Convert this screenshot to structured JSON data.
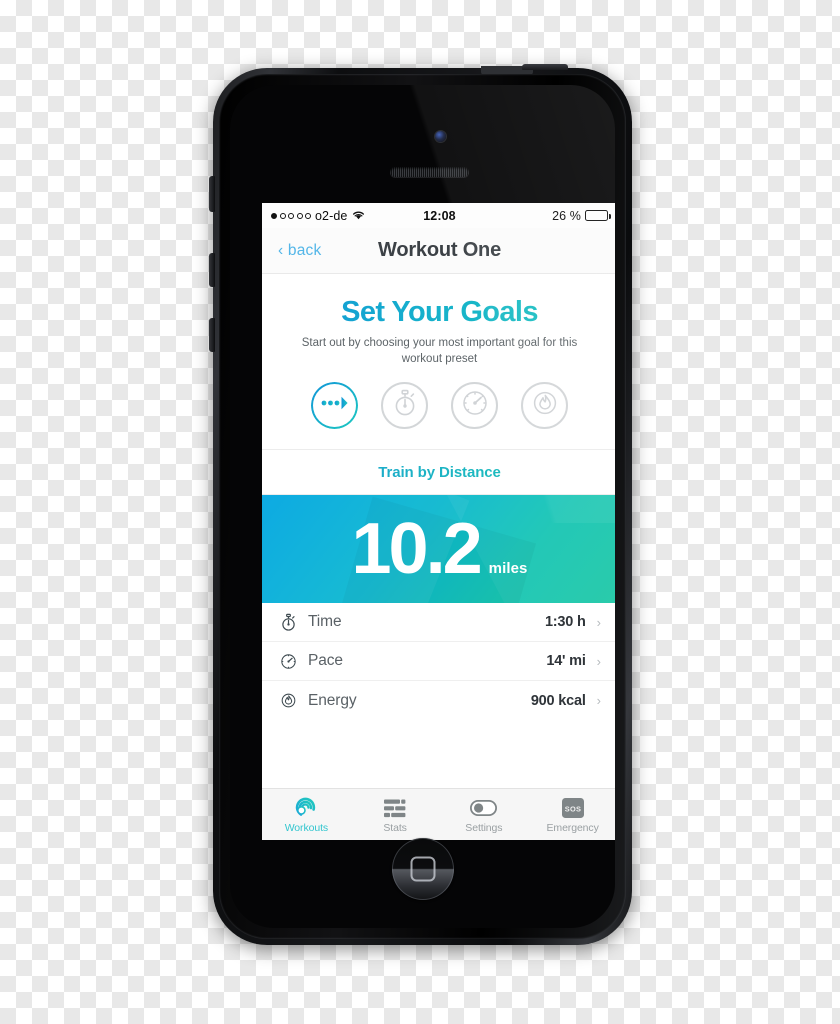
{
  "device": {
    "name": "iphone-5-black",
    "hardware": {
      "camera": "camera-icon",
      "earpiece": "earpiece-speaker",
      "home_button": "home-button-icon",
      "mute_switch": "mute-switch",
      "volume_up": "volume-up-button",
      "volume_down": "volume-down-button",
      "power": "power-button"
    }
  },
  "status_bar": {
    "signal_dots_total": 5,
    "signal_dots_filled": 1,
    "carrier": "o2-de",
    "wifi_icon": "wifi-icon",
    "time": "12:08",
    "battery_percent_label": "26 %",
    "battery_level": 26
  },
  "nav_bar": {
    "back_label": "‹ back",
    "title": "Workout One"
  },
  "goals": {
    "title": "Set Your Goals",
    "subtitle": "Start out by choosing your most important goal for this workout preset",
    "options": [
      {
        "name": "distance",
        "icon": "distance-arrow-icon",
        "active": true
      },
      {
        "name": "time",
        "icon": "stopwatch-icon",
        "active": false
      },
      {
        "name": "pace",
        "icon": "speedometer-icon",
        "active": false
      },
      {
        "name": "energy",
        "icon": "flame-icon",
        "active": false
      }
    ]
  },
  "train_label": "Train by Distance",
  "hero": {
    "value": "10.2",
    "unit": "miles",
    "gradient_start": "#00a6e2",
    "gradient_end": "#1fc9a6"
  },
  "stats": [
    {
      "icon": "stopwatch-icon",
      "label": "Time",
      "value": "1:30 h",
      "chevron": "›"
    },
    {
      "icon": "speedometer-icon",
      "label": "Pace",
      "value": "14' mi",
      "chevron": "›"
    },
    {
      "icon": "flame-icon",
      "label": "Energy",
      "value": "900 kcal",
      "chevron": "›"
    }
  ],
  "tabs": [
    {
      "label": "Workouts",
      "icon": "swirl-icon",
      "active": true
    },
    {
      "label": "Stats",
      "icon": "bars-icon",
      "active": false
    },
    {
      "label": "Settings",
      "icon": "toggle-icon",
      "active": false
    },
    {
      "label": "Emergency",
      "icon": "sos-icon",
      "active": false
    }
  ],
  "colors": {
    "accent_blue": "#1195d8",
    "accent_teal": "#1fc8bc",
    "tab_active": "#34c6cf",
    "text_dark": "#3c4146",
    "text_muted": "#9aa0a3"
  }
}
